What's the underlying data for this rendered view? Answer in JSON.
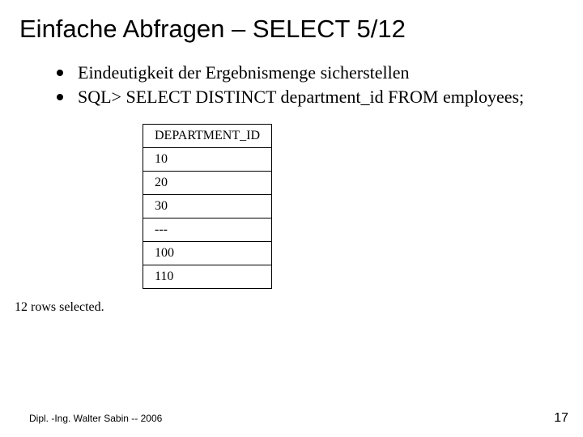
{
  "title": "Einfache Abfragen – SELECT 5/12",
  "bullets": [
    "Eindeutigkeit der Ergebnismenge sicherstellen",
    "SQL> SELECT DISTINCT department_id FROM employees;"
  ],
  "table": {
    "header": "DEPARTMENT_ID",
    "rows": [
      "10",
      "20",
      "30",
      "---",
      "100",
      "110"
    ]
  },
  "row_count_text": "12 rows selected.",
  "footer_left": "Dipl. -Ing. Walter Sabin  -- 2006",
  "page_number": "17"
}
